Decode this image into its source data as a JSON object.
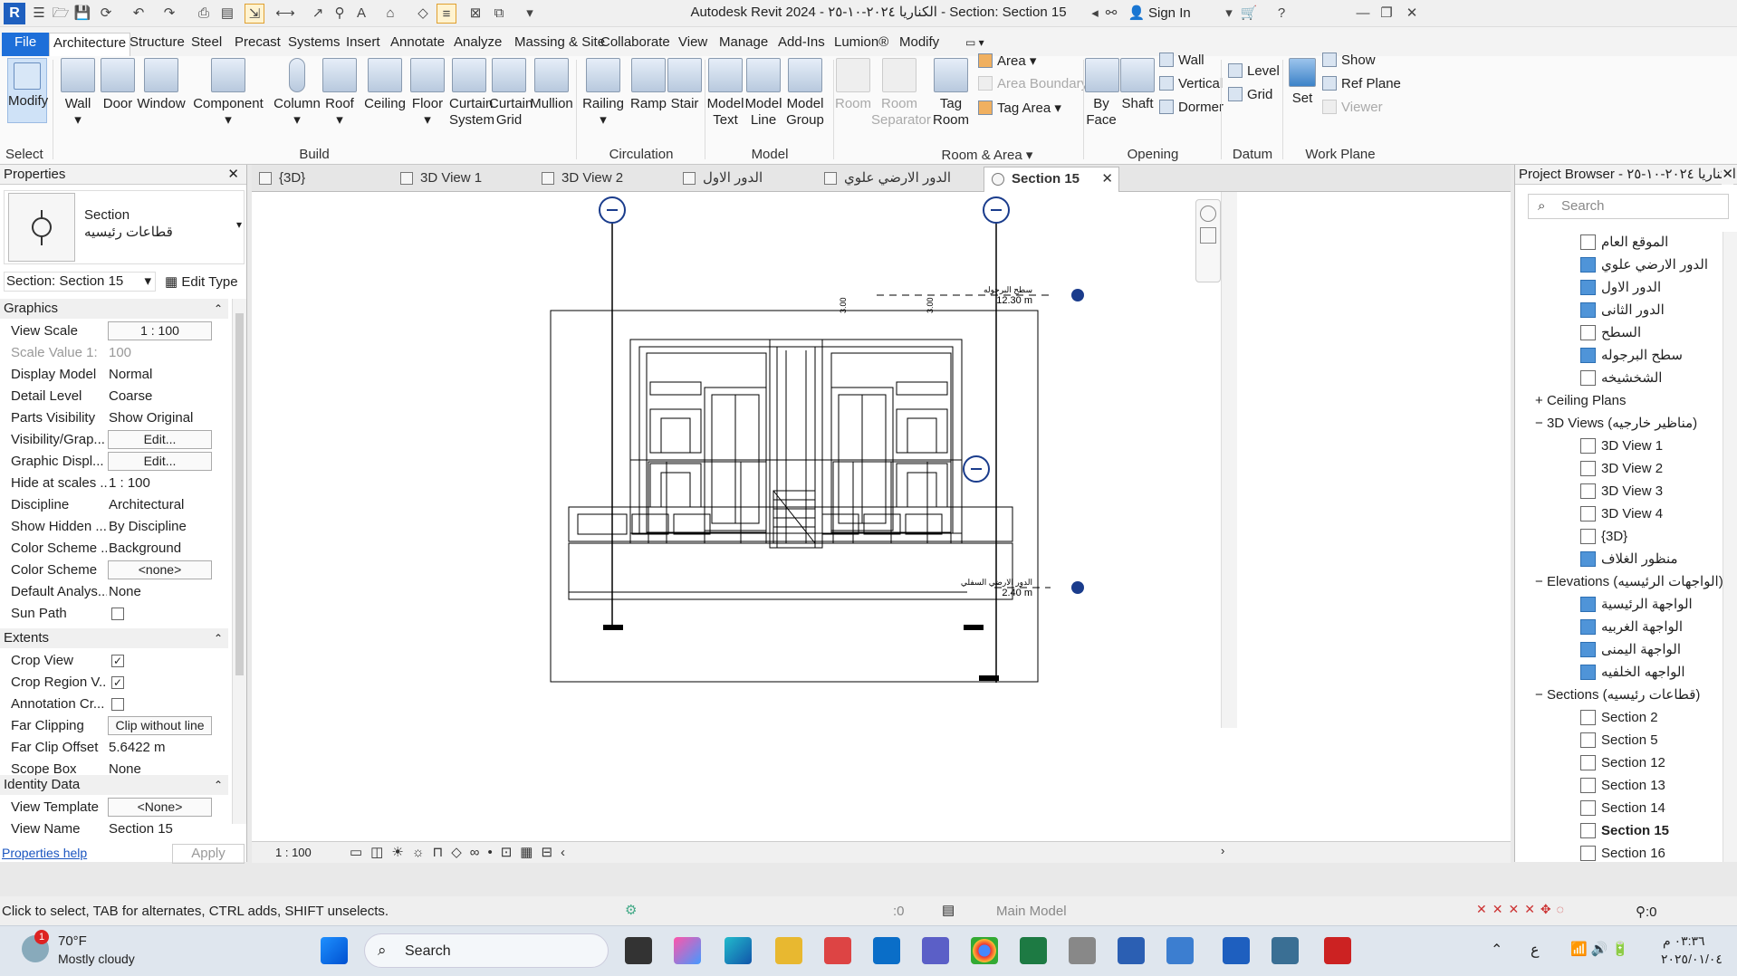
{
  "window": {
    "title": "Autodesk Revit 2024 - الكناريا ٢٠٢٤-١٠-٢٥ - Section: Section 15",
    "sign_in": "Sign In"
  },
  "ribbon_tabs": [
    "File",
    "Architecture",
    "Structure",
    "Steel",
    "Precast",
    "Systems",
    "Insert",
    "Annotate",
    "Analyze",
    "Massing & Site",
    "Collaborate",
    "View",
    "Manage",
    "Add-Ins",
    "Lumion®",
    "Modify"
  ],
  "ribbon": {
    "modify": "Modify",
    "select": "Select",
    "build": {
      "label": "Build",
      "buttons": [
        "Wall",
        "Door",
        "Window",
        "Component",
        "Column",
        "Roof",
        "Ceiling",
        "Floor",
        "Curtain System",
        "Curtain Grid",
        "Mullion"
      ]
    },
    "circulation": {
      "label": "Circulation",
      "buttons": [
        "Railing",
        "Ramp",
        "Stair"
      ]
    },
    "model": {
      "label": "Model",
      "buttons": [
        "Model Text",
        "Model Line",
        "Model Group"
      ]
    },
    "room_area": {
      "label": "Room & Area",
      "room": "Room",
      "room_separator": "Room Separator",
      "tag_room": "Tag Room",
      "area": "Area",
      "area_boundary": "Area Boundary",
      "tag_area": "Tag Area"
    },
    "opening": {
      "label": "Opening",
      "by_face": "By Face",
      "shaft": "Shaft",
      "wall": "Wall",
      "vertical": "Vertical",
      "dormer": "Dormer"
    },
    "datum": {
      "label": "Datum",
      "level": "Level",
      "grid": "Grid"
    },
    "work_plane": {
      "label": "Work Plane",
      "set": "Set",
      "show": "Show",
      "ref_plane": "Ref Plane",
      "viewer": "Viewer"
    }
  },
  "properties": {
    "title": "Properties",
    "type_family": "Section",
    "type_name": "قطاعات رئيسيه",
    "selector": "Section: Section 15",
    "edit_type": "Edit Type",
    "sections": {
      "graphics": "Graphics",
      "extents": "Extents",
      "identity": "Identity Data"
    },
    "graphics_rows": [
      {
        "k": "View Scale",
        "v": "1 : 100"
      },
      {
        "k": "Scale Value    1:",
        "v": "100"
      },
      {
        "k": "Display Model",
        "v": "Normal"
      },
      {
        "k": "Detail Level",
        "v": "Coarse"
      },
      {
        "k": "Parts Visibility",
        "v": "Show Original"
      },
      {
        "k": "Visibility/Grap...",
        "v": "Edit..."
      },
      {
        "k": "Graphic Displ...",
        "v": "Edit..."
      },
      {
        "k": "Hide at scales ...",
        "v": "1 : 100"
      },
      {
        "k": "Discipline",
        "v": "Architectural"
      },
      {
        "k": "Show Hidden ...",
        "v": "By Discipline"
      },
      {
        "k": "Color Scheme ...",
        "v": "Background"
      },
      {
        "k": "Color Scheme",
        "v": "<none>"
      },
      {
        "k": "Default Analys...",
        "v": "None"
      },
      {
        "k": "Sun Path",
        "v": ""
      }
    ],
    "extents_rows": [
      {
        "k": "Crop View",
        "v": "✓"
      },
      {
        "k": "Crop Region V...",
        "v": "✓"
      },
      {
        "k": "Annotation Cr...",
        "v": ""
      },
      {
        "k": "Far Clipping",
        "v": "Clip without line"
      },
      {
        "k": "Far Clip Offset",
        "v": "5.6422 m"
      },
      {
        "k": "Scope Box",
        "v": "None"
      }
    ],
    "identity_rows": [
      {
        "k": "View Template",
        "v": "<None>"
      },
      {
        "k": "View Name",
        "v": "Section 15"
      }
    ],
    "help": "Properties help",
    "apply": "Apply"
  },
  "view_tabs": [
    "{3D}",
    "3D View 1",
    "3D View 2",
    "الدور الاول",
    "الدور الارضي علوي",
    "Section 15"
  ],
  "canvas": {
    "scale": "1 : 100",
    "level_top_name": "سطح البرجوله",
    "level_top_value": "12.30 m",
    "level_bottom_name": "الدور الارضي السفلي",
    "level_bottom_value": "2.40 m",
    "dim1": "3.00",
    "dim2": "3.00"
  },
  "browser": {
    "title": "Project Browser - الكناريا ٢٠٢٤-١٠-٢٥",
    "search_placeholder": "Search",
    "plan_items": [
      "الموقع العام",
      "الدور الارضي علوي",
      "الدور الاول",
      "الدور الثانى",
      "السطح",
      "سطح البرجوله",
      "الشخشيخه"
    ],
    "ceiling_plans": "Ceiling Plans",
    "views3d_header": "3D Views (مناظير خارجيه)",
    "views3d": [
      "3D View 1",
      "3D View 2",
      "3D View 3",
      "3D View 4",
      "{3D}",
      "منظور الغلاف"
    ],
    "elevations_header": "Elevations (الواجهات الرئيسيه)",
    "elevations": [
      "الواجهة الرئيسية",
      "الواجهة الغربيه",
      "الواجهة اليمنى",
      "الواجهه الخلفيه"
    ],
    "sections_header": "Sections (قطاعات رئيسيه)",
    "sections": [
      "Section 2",
      "Section 5",
      "Section 12",
      "Section 13",
      "Section 14",
      "Section 15",
      "Section 16"
    ]
  },
  "status": {
    "hint": "Click to select, TAB for alternates, CTRL adds, SHIFT unselects.",
    "model": "Main Model",
    "zero": ":0",
    "filter": ":0"
  },
  "taskbar": {
    "weather_temp": "70°F",
    "weather_desc": "Mostly cloudy",
    "weather_badge": "1",
    "search": "Search",
    "lang": "ع",
    "time": "٠٣:٣٦ م",
    "date": "٢٠٢٥/٠١/٠٤"
  }
}
